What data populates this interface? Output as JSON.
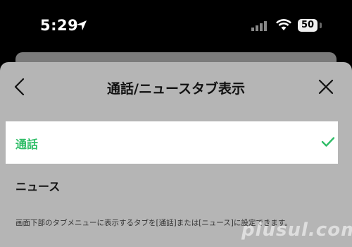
{
  "status_bar": {
    "time": "5:29",
    "battery_level": "50"
  },
  "sheet": {
    "title": "通話/ニュースタブ表示",
    "options": [
      {
        "label": "通話",
        "selected": true
      },
      {
        "label": "ニュース",
        "selected": false
      }
    ],
    "description": "画面下部のタブメニューに表示するタブを[通話]または[ニュース]に設定できます。"
  },
  "watermark": "plusul.com",
  "colors": {
    "accent": "#2fbd67",
    "overlay": "#b5b5b5",
    "background": "#000000"
  },
  "icons": [
    "location-arrow-icon",
    "cellular-signal-icon",
    "wifi-icon",
    "battery-icon",
    "back-chevron-icon",
    "close-icon",
    "check-icon"
  ]
}
